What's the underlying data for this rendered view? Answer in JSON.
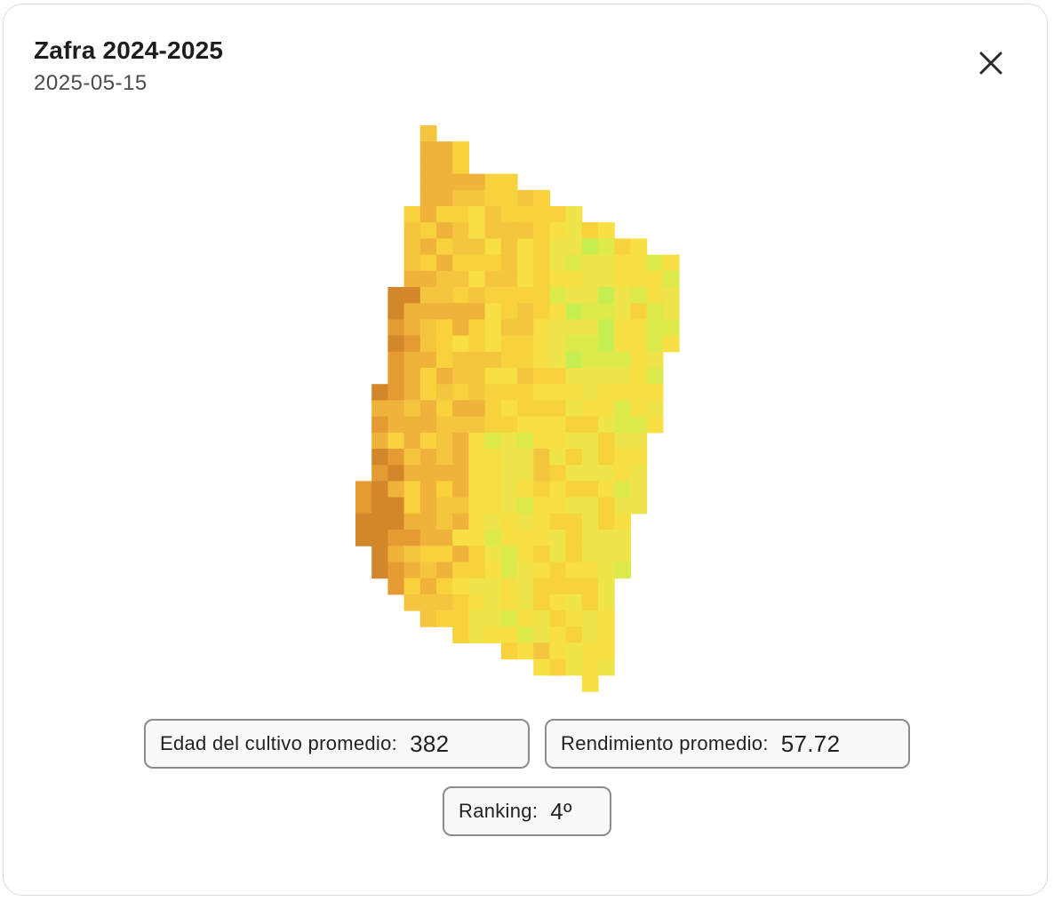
{
  "modal": {
    "title": "Zafra 2024-2025",
    "date": "2025-05-15",
    "close_icon": "close-icon"
  },
  "stats": {
    "age_label": "Edad del cultivo promedio:",
    "age_value": "382",
    "yield_label": "Rendimiento promedio:",
    "yield_value": "57.72",
    "ranking_label": "Ranking:",
    "ranking_value": "4º"
  },
  "colors": {
    "border": "#dcdcdc",
    "pill_border": "#8c8c8c",
    "pill_bg": "#f7f8f7",
    "map_low": "#d4862a",
    "map_mid": "#f7d23c",
    "map_high": "#c5ee50"
  }
}
